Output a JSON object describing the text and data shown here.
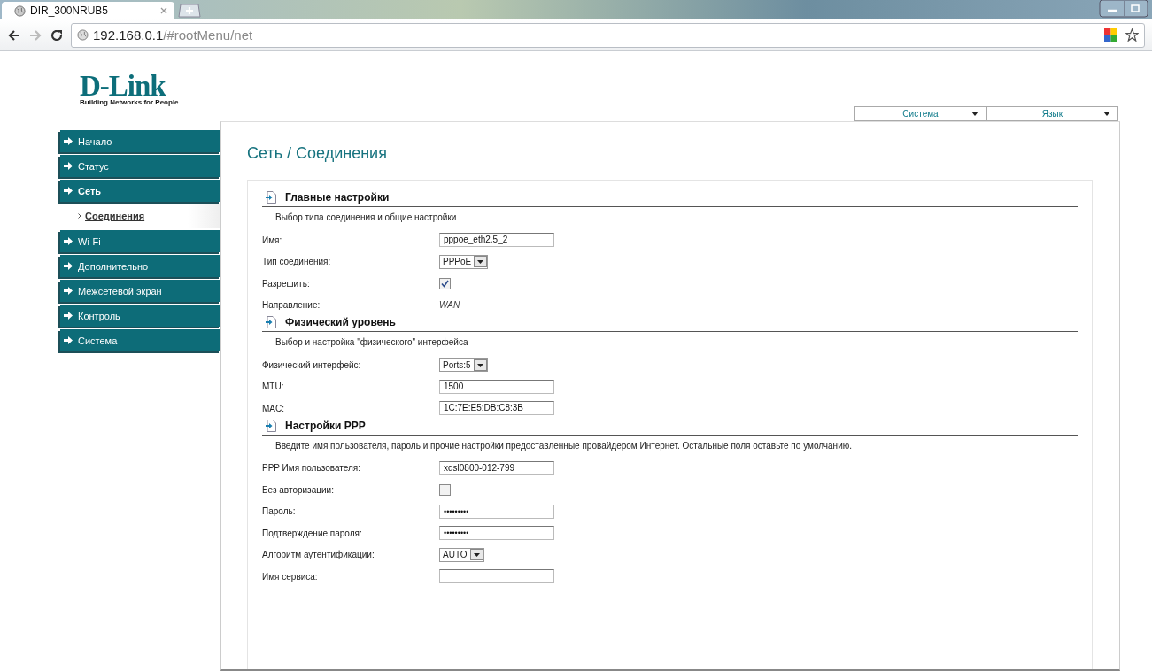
{
  "browser": {
    "tab_title": "DIR_300NRUB5",
    "url_host": "192.168.0.1",
    "url_path": "/#rootMenu/net"
  },
  "logo": {
    "brand": "D-Link",
    "tagline": "Building Networks for People"
  },
  "top_menus": [
    {
      "label": "Система"
    },
    {
      "label": "Язык"
    }
  ],
  "sidebar": {
    "items": [
      {
        "label": "Начало",
        "selected": false
      },
      {
        "label": "Статус",
        "selected": false
      },
      {
        "label": "Сеть",
        "selected": true,
        "children": [
          {
            "label": "Соединения",
            "selected": true
          }
        ]
      },
      {
        "label": "Wi-Fi",
        "selected": false
      },
      {
        "label": "Дополнительно",
        "selected": false
      },
      {
        "label": "Межсетевой экран",
        "selected": false
      },
      {
        "label": "Контроль",
        "selected": false
      },
      {
        "label": "Система",
        "selected": false
      }
    ]
  },
  "page_title": "Сеть / Соединения",
  "sections": [
    {
      "title": "Главные настройки",
      "description": "Выбор типа соединения и общие настройки",
      "fields": [
        {
          "kind": "text",
          "label": "Имя:",
          "value": "pppoe_eth2.5_2"
        },
        {
          "kind": "select",
          "label": "Тип соединения:",
          "value": "PPPoE"
        },
        {
          "kind": "checkbox",
          "label": "Разрешить:",
          "checked": true
        },
        {
          "kind": "static",
          "label": "Направление:",
          "value": "WAN"
        }
      ]
    },
    {
      "title": "Физический уровень",
      "description": "Выбор и настройка \"физического\" интерфейса",
      "fields": [
        {
          "kind": "select",
          "label": "Физический интерфейс:",
          "value": "Ports:5"
        },
        {
          "kind": "text",
          "label": "MTU:",
          "value": "1500"
        },
        {
          "kind": "text",
          "label": "MAC:",
          "value": "1C:7E:E5:DB:C8:3B"
        }
      ]
    },
    {
      "title": "Настройки PPP",
      "description": "Введите имя пользователя, пароль и прочие настройки предоставленные провайдером Интернет. Остальные поля оставьте по умолчанию.",
      "fields": [
        {
          "kind": "text",
          "label": "PPP Имя пользователя:",
          "value": "xdsl0800-012-799"
        },
        {
          "kind": "checkbox",
          "label": "Без авторизации:",
          "checked": false
        },
        {
          "kind": "password",
          "label": "Пароль:",
          "value": "•••••••••"
        },
        {
          "kind": "password",
          "label": "Подтверждение пароля:",
          "value": "•••••••••"
        },
        {
          "kind": "select",
          "label": "Алгоритм аутентификации:",
          "value": "AUTO"
        },
        {
          "kind": "text",
          "label": "Имя сервиса:"
        }
      ]
    }
  ]
}
